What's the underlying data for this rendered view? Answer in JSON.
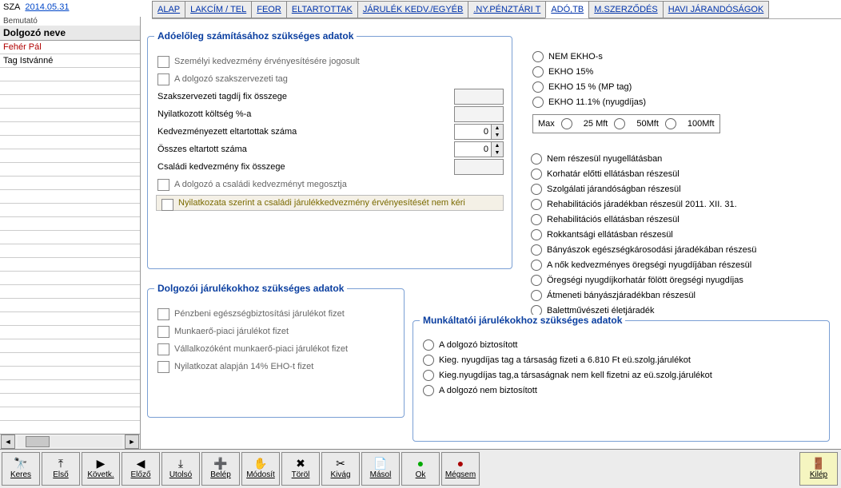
{
  "header": {
    "sza_label": "SZA",
    "date": "2014.05.31",
    "bemutato": "Bemutató"
  },
  "tabs": [
    "ALAP",
    "LAKCÍM / TEL",
    "FEOR",
    "ELTARTOTTAK",
    "JÁRULÉK KEDV./EGYÉB",
    ".NY.PÉNZTÁRI T",
    "ADÓ,TB",
    "M.SZERZŐDÉS",
    "HAVI JÁRANDÓSÁGOK"
  ],
  "active_tab": 6,
  "sidebar": {
    "header": "Dolgozó neve",
    "items": [
      "Fehér Pál",
      "Tag Istvánné"
    ]
  },
  "panel1": {
    "title": "Adóelőleg számításához  szükséges adatok",
    "chk_szemelyi": "Személyi kedvezmény érvényesítésére jogosult",
    "chk_szaksz": "A dolgozó szakszervezeti tag",
    "lbl_tagdij": "Szakszervezeti tagdíj fix összege",
    "lbl_koltseg": "Nyilatkozott költség %-a",
    "lbl_kedv_elt": "Kedvezményezett eltartottak száma",
    "val_kedv_elt": "0",
    "lbl_ossz_elt": "Összes eltartott száma",
    "val_ossz_elt": "0",
    "lbl_csaladi": "Családi kedvezmény fix összege",
    "chk_megoszt": "A dolgozó a családi kedvezményt megosztja",
    "chk_nemkeri": "Nyilatkozata szerint a családi járulékkedvezmény érvényesítését nem kéri"
  },
  "ekho": {
    "opts": [
      "NEM EKHO-s",
      "EKHO 15%",
      "EKHO 15 % (MP tag)",
      "EKHO 11.1% (nyugdíjas)"
    ],
    "max_label": "Max",
    "max_opts": [
      "25 Mft",
      "50Mft",
      "100Mft"
    ]
  },
  "nyug": {
    "opts": [
      "Nem részesül nyugellátásban",
      "Korhatár előtti ellátásban részesül",
      "Szolgálati  járandóságban részesül",
      "Rehabilitációs járadékban részesül 2011. XII. 31.",
      "Rehabilitációs ellátásban részesül",
      "Rokkantsági ellátásban részesül",
      "Bányászok egészségkárosodási járadékában részesü",
      "A nők kedvezményes öregségi nyugdíjában részesül",
      "Öregségi nyugdíjkorhatár fölött öregségi nyugdíjas",
      "Átmeneti bányászjáradékban részesül",
      "Balettművészeti életjáradék"
    ]
  },
  "panel2": {
    "title": "Dolgozói járulékokhoz szükséges adatok",
    "opts": [
      "Pénzbeni egészségbiztosítási járulékot fizet",
      "Munkaerő-piaci járulékot fizet",
      "Vállalkozóként munkaerő-piaci járulékot fizet",
      "Nyilatkozat alapján 14% EHO-t fizet"
    ]
  },
  "panel3": {
    "title": "Munkáltatói járulékokhoz szükséges adatok",
    "opts": [
      "A dolgozó biztosított",
      "Kieg. nyugdíjas tag a társaság fizeti a 6.810 Ft eü.szolg.járulékot",
      "Kieg.nyugdíjas tag,a társaságnak nem kell fizetni az eü.szolg.járulékot",
      "A dolgozó nem biztosított"
    ]
  },
  "toolbar": {
    "keres": "Keres",
    "elso": "Első",
    "kovetk": "Követk.",
    "elozo": "Előző",
    "utolso": "Utolsó",
    "belep": "Belép",
    "modosit": "Módosít",
    "torol": "Töröl",
    "kivag": "Kivág",
    "masol": "Másol",
    "ok": "Ok",
    "megsem": "Mégsem",
    "kilep": "Kilép"
  }
}
